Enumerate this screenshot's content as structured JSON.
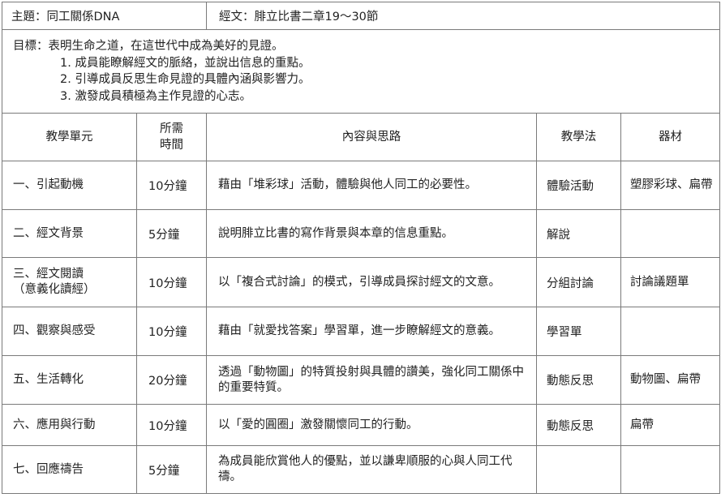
{
  "header": {
    "topic": "主題：同工關係DNA",
    "scripture": "經文：腓立比書二章19～30節"
  },
  "goals": {
    "main": "目標：表明生命之道，在這世代中成為美好的見證。",
    "items": [
      "1. 成員能瞭解經文的脈絡，並說出信息的重點。",
      "2. 引導成員反思生命見證的具體內涵與影響力。",
      "3. 激發成員積極為主作見證的心志。"
    ]
  },
  "columns": {
    "unit": "教學單元",
    "time_line1": "所需",
    "time_line2": "時間",
    "content": "內容與思路",
    "method": "教學法",
    "material": "器材"
  },
  "rows": [
    {
      "unit": "一、引起動機",
      "unit2": "",
      "time": "10分鐘",
      "content": "藉由「堆彩球」活動，體驗與他人同工的必要性。",
      "method": "體驗活動",
      "material": "塑膠彩球、扁帶"
    },
    {
      "unit": "二、經文背景",
      "unit2": "",
      "time": "5分鐘",
      "content": "說明腓立比書的寫作背景與本章的信息重點。",
      "method": "解說",
      "material": ""
    },
    {
      "unit": "三、經文閱讀",
      "unit2": "（意義化讀經）",
      "time": "10分鐘",
      "content": "以「複合式討論」的模式，引導成員探討經文的文意。",
      "method": "分組討論",
      "material": "討論議題單"
    },
    {
      "unit": "四、觀察與感受",
      "unit2": "",
      "time": "10分鐘",
      "content": "藉由「就愛找答案」學習單，進一步瞭解經文的意義。",
      "method": "學習單",
      "material": ""
    },
    {
      "unit": "五、生活轉化",
      "unit2": "",
      "time": "20分鐘",
      "content": "透過「動物圖」的特質投射與具體的讚美，強化同工關係中的重要特質。",
      "method": "動態反思",
      "material": "動物圖、扁帶"
    },
    {
      "unit": "六、應用與行動",
      "unit2": "",
      "time": "10分鐘",
      "content": "以「愛的圓圈」激發關懷同工的行動。",
      "method": "動態反思",
      "material": "扁帶"
    },
    {
      "unit": "七、回應禱告",
      "unit2": "",
      "time": "5分鐘",
      "content": "為成員能欣賞他人的優點，並以謙卑順服的心與人同工代禱。",
      "method": "",
      "material": ""
    }
  ]
}
